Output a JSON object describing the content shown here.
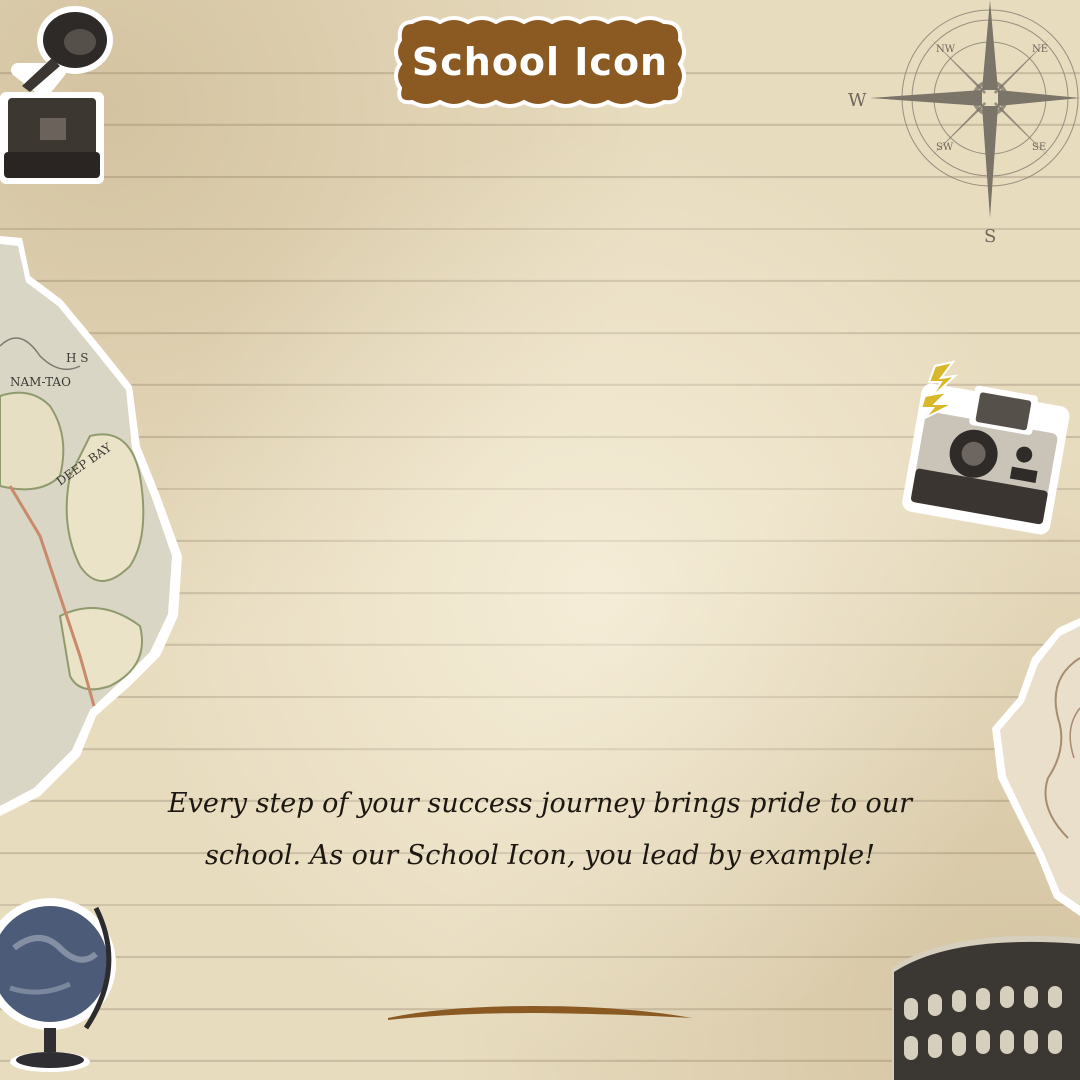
{
  "header": {
    "title": "School Icon"
  },
  "body": {
    "message": "Every step of your success journey brings pride to our school. As our School Icon, you lead by example!"
  },
  "colors": {
    "paper": "#e8dcbf",
    "badge_fill": "#8a5a22",
    "underline": "#8a5a22",
    "text": "#1c1711"
  },
  "decorations": {
    "compass": {
      "labels": [
        "W",
        "S",
        "NW",
        "NE",
        "SW",
        "SE"
      ]
    },
    "map_left": {
      "labels": [
        "NAM-TAO",
        "DEEP BAY",
        "H S"
      ]
    },
    "icons": [
      "gramophone-icon",
      "compass-icon",
      "instant-camera-icon",
      "globe-icon",
      "colosseum-icon",
      "vintage-map-left",
      "vintage-map-right"
    ]
  }
}
